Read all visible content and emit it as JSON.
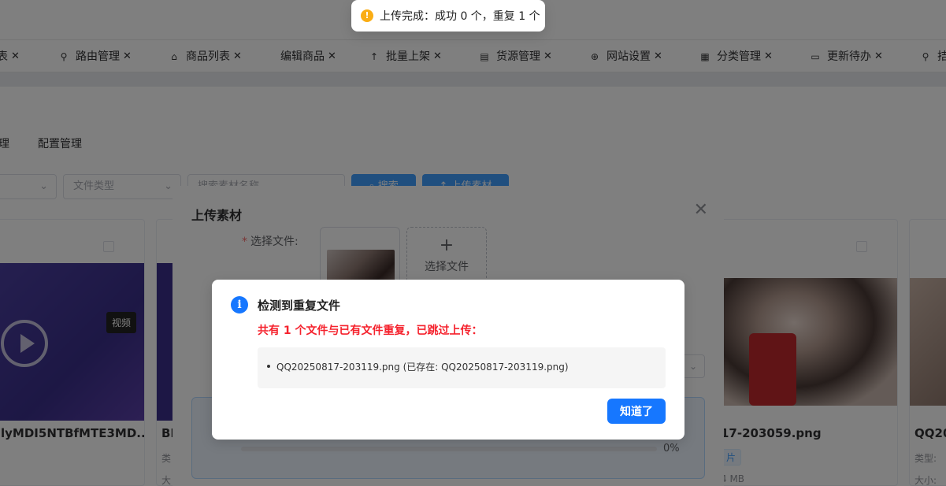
{
  "tabs": [
    {
      "label": "表",
      "icon": "list-icon"
    },
    {
      "label": "路由管理",
      "icon": "link-icon"
    },
    {
      "label": "商品列表",
      "icon": "bag-icon"
    },
    {
      "label": "编辑商品",
      "icon": ""
    },
    {
      "label": "批量上架",
      "icon": "arrow-up-icon"
    },
    {
      "label": "货源管理",
      "icon": "document-icon"
    },
    {
      "label": "网站设置",
      "icon": "globe-icon"
    },
    {
      "label": "分类管理",
      "icon": "grid-icon"
    },
    {
      "label": "更新待办",
      "icon": "calendar-icon"
    },
    {
      "label": "拮",
      "icon": "link-icon"
    }
  ],
  "tab_close_glyph": "✕",
  "subtabs": [
    "理",
    "配置管理"
  ],
  "filters": {
    "file_type_placeholder": "文件类型",
    "search_placeholder": "搜索素材名称",
    "search_button": "搜索",
    "upload_button": "上传素材"
  },
  "cards": [
    {
      "title": "lyMDI5NTBfMTE3MD...",
      "badge": "视频",
      "type_label": "",
      "size_label": ""
    },
    {
      "title": "BN",
      "type_label": "类",
      "size_label": "大"
    },
    {
      "title": "17-203059.png",
      "badge": "片",
      "size_label": "4 MB"
    },
    {
      "title": "QQ20",
      "type_label": "类型:",
      "size_label": "大小:"
    }
  ],
  "upload_dialog": {
    "title": "上传素材",
    "close_glyph": "✕",
    "required_mark": "*",
    "select_file_label": "选择文件:",
    "select_file_button": "选择文件",
    "plus_glyph": "+",
    "progress_percent_text": "0%",
    "progress": 0
  },
  "message_box": {
    "icon_glyph": "i",
    "title": "检测到重复文件",
    "summary": "共有 1 个文件与已有文件重复，已跳过上传：",
    "duplicates": [
      "QQ20250817-203119.png (已存在: QQ20250817-203119.png)"
    ],
    "ok_label": "知道了"
  },
  "toast": {
    "icon_glyph": "!",
    "text": "上传完成：成功 0 个，重复 1 个"
  },
  "colors": {
    "primary": "#1677ff",
    "warning": "#faad14",
    "danger": "#f5222d"
  }
}
